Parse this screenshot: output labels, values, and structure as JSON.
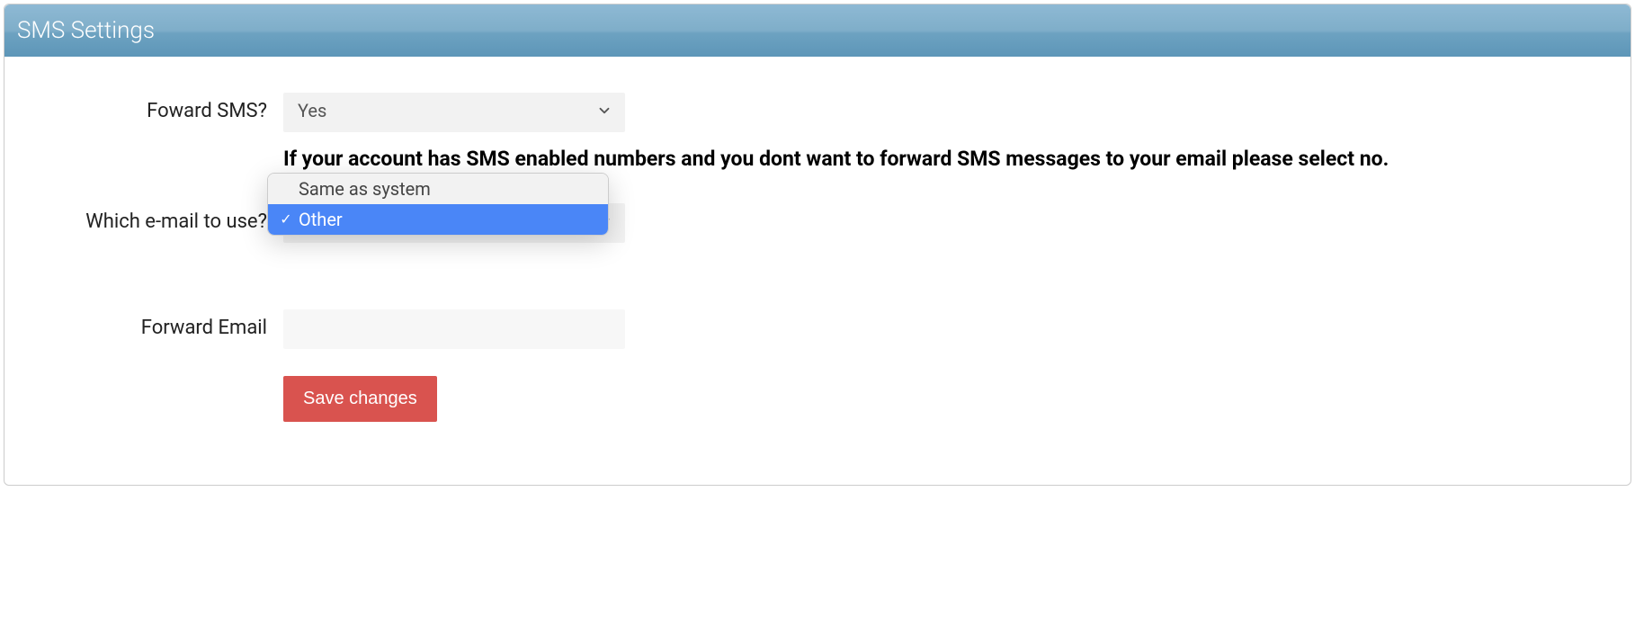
{
  "panel": {
    "title": "SMS Settings"
  },
  "form": {
    "forward_sms": {
      "label": "Foward SMS?",
      "value": "Yes",
      "help": "If your account has SMS enabled numbers and you dont want to forward SMS messages to your email please select no."
    },
    "email_select": {
      "label": "Which e-mail to use?",
      "options": [
        {
          "label": "Same as system",
          "selected": false
        },
        {
          "label": "Other",
          "selected": true
        }
      ]
    },
    "forward_email": {
      "label": "Forward Email",
      "value": ""
    },
    "save_button": "Save changes"
  }
}
